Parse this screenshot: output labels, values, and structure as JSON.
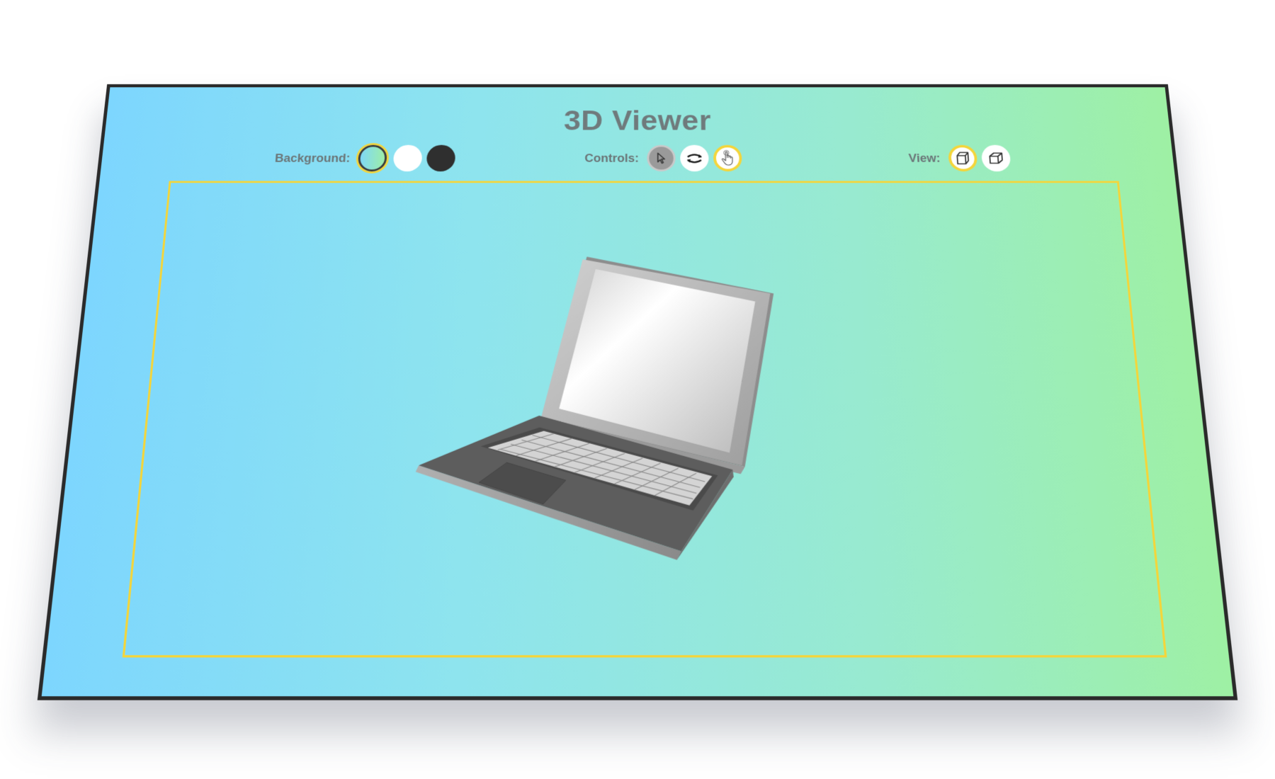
{
  "app": {
    "title": "3D Viewer"
  },
  "toolbar": {
    "background": {
      "label": "Background:",
      "options": [
        "gradient",
        "white",
        "dark"
      ],
      "selected": "gradient"
    },
    "controls": {
      "label": "Controls:",
      "options": [
        "select-pointer-icon",
        "rotate-arrows-icon",
        "hand-pointer-icon"
      ],
      "selected": "hand-pointer-icon"
    },
    "view": {
      "label": "View:",
      "options": [
        "perspective-cube-icon",
        "orthographic-cube-icon"
      ],
      "selected": "perspective-cube-icon"
    }
  },
  "viewport": {
    "model": "laptop"
  },
  "colors": {
    "accent": "#f4d53a",
    "title": "#6f7a7c",
    "gradient_start": "#7dd6fe",
    "gradient_end": "#9ef0a4",
    "frame": "#2a2a2a"
  }
}
